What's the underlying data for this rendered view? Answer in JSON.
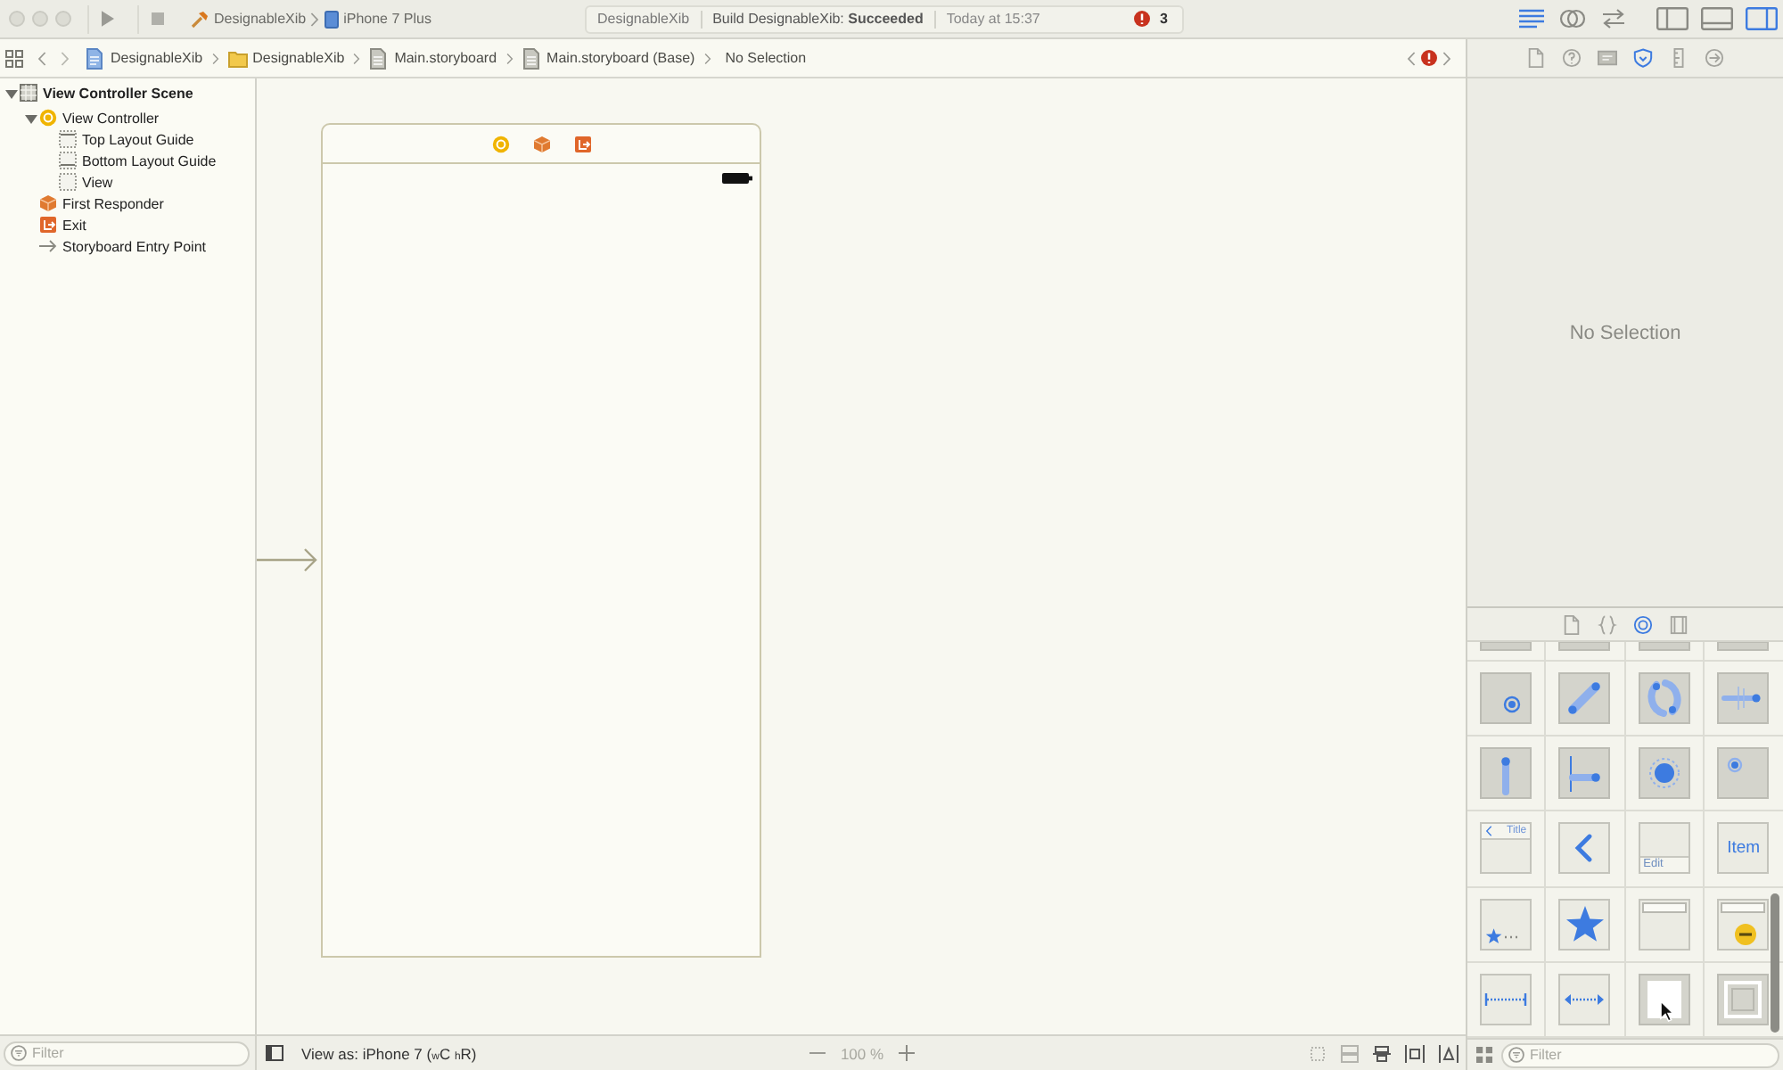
{
  "toolbar": {
    "scheme": "DesignableXib",
    "device": "iPhone 7 Plus",
    "editor_modes": [
      {
        "kind": "standard",
        "selected": true
      },
      {
        "kind": "assistant",
        "selected": false
      },
      {
        "kind": "version",
        "selected": false
      }
    ],
    "panels": [
      {
        "kind": "navigator",
        "selected": false
      },
      {
        "kind": "debug",
        "selected": false
      },
      {
        "kind": "utilities",
        "selected": true
      }
    ]
  },
  "activity": {
    "project": "DesignableXib",
    "status": "Build DesignableXib: **Succeeded**",
    "time": "Today at 15:37",
    "issues": "3"
  },
  "jump_bar": {
    "items": [
      {
        "kind": "project",
        "label": "DesignableXib"
      },
      {
        "kind": "folder",
        "label": "DesignableXib"
      },
      {
        "kind": "storyboard",
        "label": "Main.storyboard"
      },
      {
        "kind": "storyboard",
        "label": "Main.storyboard (Base)"
      },
      {
        "kind": "none",
        "label": "No Selection"
      }
    ]
  },
  "navigator": {
    "tree": [
      {
        "label": "View Controller Scene",
        "kind": "scene",
        "expanded": true,
        "children": [
          {
            "label": "View Controller",
            "kind": "controller",
            "expanded": true,
            "children": [
              {
                "label": "Top Layout Guide",
                "kind": "top_guide"
              },
              {
                "label": "Bottom Layout Guide",
                "kind": "bottom_guide"
              },
              {
                "label": "View",
                "kind": "view"
              }
            ]
          },
          {
            "label": "First Responder",
            "kind": "responder"
          },
          {
            "label": "Exit",
            "kind": "exit"
          },
          {
            "label": "Storyboard Entry Point",
            "kind": "entry"
          }
        ]
      }
    ],
    "filter": {
      "placeholder": "Filter"
    }
  },
  "canvas": {
    "view_as": "View as: iPhone 7 ($_{w}$C $_{h}$R)",
    "zoom": "100 %"
  },
  "inspector": {
    "tabs": [
      {
        "kind": "file",
        "selected": false
      },
      {
        "kind": "help",
        "selected": false
      },
      {
        "kind": "identity",
        "selected": false
      },
      {
        "kind": "attributes",
        "selected": true
      },
      {
        "kind": "size",
        "selected": false
      },
      {
        "kind": "connections",
        "selected": false
      }
    ],
    "message": "No Selection"
  },
  "library": {
    "tabs": [
      {
        "kind": "file",
        "selected": false
      },
      {
        "kind": "code",
        "selected": false
      },
      {
        "kind": "object",
        "selected": true
      },
      {
        "kind": "media",
        "selected": false
      }
    ],
    "items": [
      {
        "kind": "clipped"
      },
      {
        "kind": "clipped"
      },
      {
        "kind": "clipped"
      },
      {
        "kind": "clipped"
      },
      {
        "kind": "tap"
      },
      {
        "kind": "pinch"
      },
      {
        "kind": "rotation"
      },
      {
        "kind": "swipe"
      },
      {
        "kind": "pan"
      },
      {
        "kind": "edge_pan"
      },
      {
        "kind": "long_press"
      },
      {
        "kind": "custom"
      },
      {
        "kind": "nav_item",
        "label": "Title"
      },
      {
        "kind": "back_button"
      },
      {
        "kind": "bar_button",
        "label": "Edit"
      },
      {
        "kind": "text_item",
        "label": "Item"
      },
      {
        "kind": "tab_bar_item"
      },
      {
        "kind": "star"
      },
      {
        "kind": "top_bar"
      },
      {
        "kind": "search_minus"
      },
      {
        "kind": "flexible_space"
      },
      {
        "kind": "fixed_space"
      },
      {
        "kind": "view"
      },
      {
        "kind": "container"
      }
    ],
    "filter": {
      "placeholder": "Filter"
    }
  }
}
